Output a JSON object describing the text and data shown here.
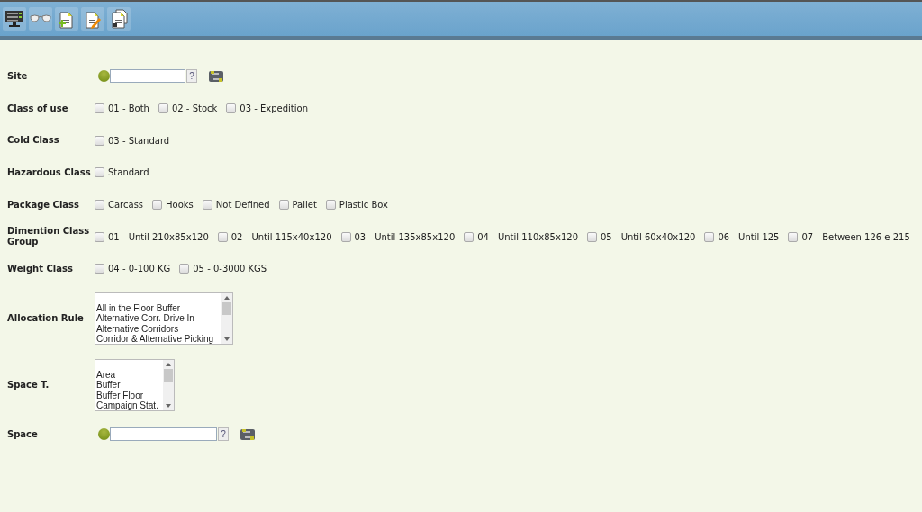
{
  "toolbar": {
    "buttons": [
      {
        "kind": "monitor"
      },
      {
        "kind": "glasses"
      },
      {
        "kind": "new-document"
      },
      {
        "kind": "edit-document"
      },
      {
        "kind": "copy-document"
      }
    ]
  },
  "form": {
    "rows": [
      {
        "kind": "lookup",
        "label": "Site",
        "help": "?"
      },
      {
        "kind": "checkboxes",
        "label": "Class of use",
        "options": [
          {
            "label": "01 - Both",
            "checked": false
          },
          {
            "label": "02 - Stock",
            "checked": false
          },
          {
            "label": "03 - Expedition",
            "checked": false
          }
        ]
      },
      {
        "kind": "checkboxes",
        "label": "Cold Class",
        "options": [
          {
            "label": "03 - Standard",
            "checked": false
          }
        ]
      },
      {
        "kind": "checkboxes",
        "label": "Hazardous Class",
        "options": [
          {
            "label": "Standard",
            "checked": false
          }
        ]
      },
      {
        "kind": "checkboxes",
        "label": "Package Class",
        "options": [
          {
            "label": "Carcass",
            "checked": false
          },
          {
            "label": "Hooks",
            "checked": false
          },
          {
            "label": "Not Defined",
            "checked": false
          },
          {
            "label": "Pallet",
            "checked": false
          },
          {
            "label": "Plastic Box",
            "checked": false
          }
        ]
      },
      {
        "kind": "checkboxes",
        "label": "Dimention Class Group",
        "options": [
          {
            "label": "01 - Until 210x85x120",
            "checked": false
          },
          {
            "label": "02 - Until 115x40x120",
            "checked": false
          },
          {
            "label": "03 - Until 135x85x120",
            "checked": false
          },
          {
            "label": "04 - Until 110x85x120",
            "checked": false
          },
          {
            "label": "05 - Until 60x40x120",
            "checked": false
          },
          {
            "label": "06 - Until 125",
            "checked": false
          },
          {
            "label": "07 - Between 126 e 215",
            "checked": false
          }
        ]
      },
      {
        "kind": "checkboxes",
        "label": "Weight Class",
        "options": [
          {
            "label": "04 - 0-100 KG",
            "checked": false
          },
          {
            "label": "05 - 0-3000 KGS",
            "checked": false
          }
        ]
      },
      {
        "kind": "listbox",
        "label": "Allocation Rule",
        "items": [
          "All in the Floor Buffer",
          "Alternative Corr. Drive In",
          "Alternative Corridors",
          "Corridor & Alternative Picking"
        ]
      },
      {
        "kind": "listbox",
        "label": "Space T.",
        "items": [
          "Area",
          "Buffer",
          "Buffer Floor",
          "Campaign Stat."
        ]
      },
      {
        "kind": "lookup",
        "label": "Space",
        "help": "?"
      }
    ]
  }
}
